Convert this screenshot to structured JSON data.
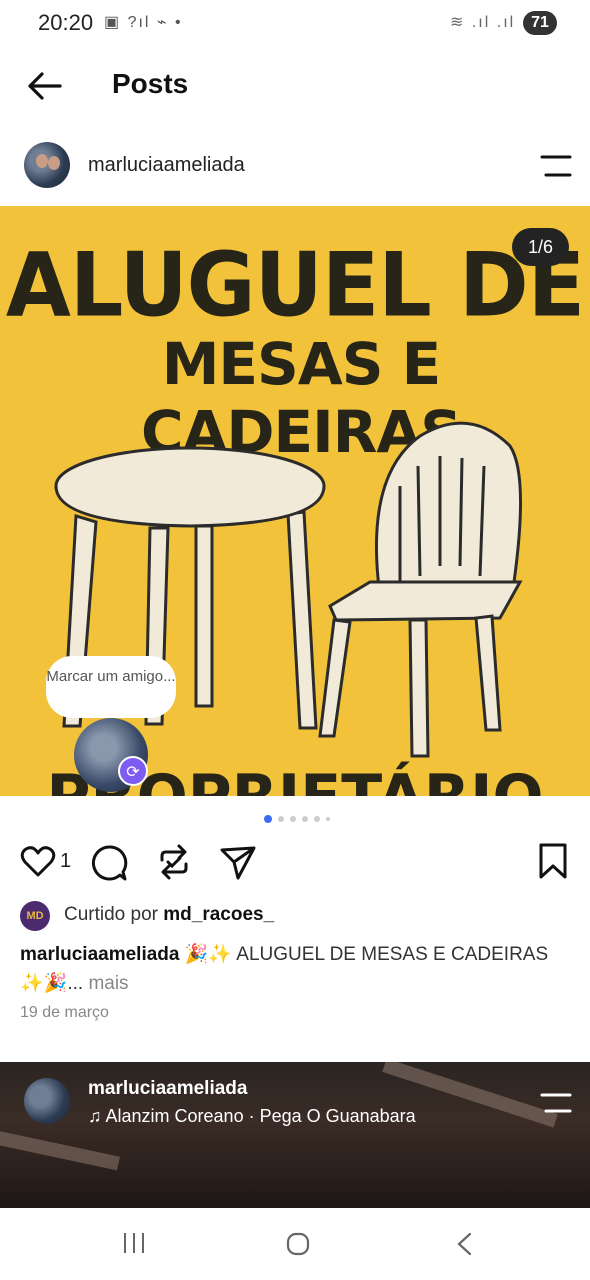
{
  "status_bar": {
    "time": "20:20",
    "left_icons": "▣ ?ıl ⌁ •",
    "right_icons": "≋ .ıl .ıl",
    "battery": "71"
  },
  "header": {
    "title": "Posts",
    "back_icon": "arrow-left-icon"
  },
  "post": {
    "username": "marluciaameliada",
    "menu_icon": "menu-icon",
    "image": {
      "headline_line1": "ALUGUEL DE",
      "headline_line2": "MESAS E CADEIRAS",
      "headline_line3": "PROPRIETÁRIO",
      "counter": "1/6",
      "background_color": "#f2c33a",
      "tag_prompt": "Marcar um amigo...",
      "repost_badge_icon": "repost-icon"
    },
    "carousel": {
      "total": 6,
      "active": 0
    },
    "likes_count": "1",
    "liked_by_prefix": "Curtido por",
    "liked_by_user": "md_racoes_",
    "liked_avatar_text": "MD",
    "caption_user": "marluciaameliada",
    "caption_text": "🎉✨ ALUGUEL DE MESAS E CADEIRAS ✨🎉...",
    "caption_more": "mais",
    "date": "19 de março"
  },
  "next_post": {
    "username": "marluciaameliada",
    "music": "Alanzim Coreano · Pega O Guanabara"
  },
  "nav": {
    "recent_icon": "recent-apps-icon",
    "home_icon": "home-icon",
    "back_icon": "back-chevron-icon"
  }
}
